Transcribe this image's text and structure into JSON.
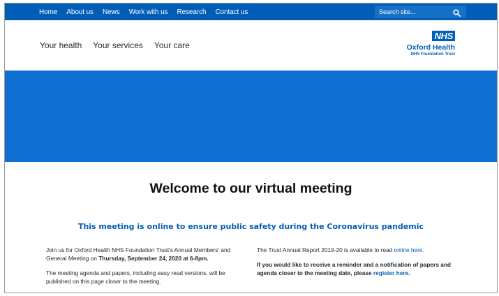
{
  "topbar": {
    "nav": [
      "Home",
      "About us",
      "News",
      "Work with us",
      "Research",
      "Contact us"
    ],
    "search_placeholder": "Search site..."
  },
  "header": {
    "nav": [
      "Your health",
      "Your services",
      "Your care"
    ],
    "logo": {
      "badge": "NHS",
      "name": "Oxford Health",
      "sub": "NHS Foundation Trust"
    }
  },
  "colors": {
    "nhs_blue": "#005eb8",
    "banner": "#0f6fd3"
  },
  "content": {
    "title": "Welcome to our virtual meeting",
    "subheading": "This meeting is online to ensure public safety during the Coronavirus pandemic",
    "left": {
      "p1_text": "Join us for Oxford Health NHS Foundation Trust's Annual Members' and General Meeting on ",
      "p1_bold": "Thursday, September 24, 2020 at 6-8pm.",
      "p2": "The meeting agenda and papers, including easy read versions, will be published on this page closer to the meeting."
    },
    "right": {
      "p1_text": "The Trust Annual Report 2019-20 is available to read ",
      "p1_link": "online here.",
      "p2_text": "If you would like to receive a reminder and a notification of papers and agenda closer to the meeting date, please ",
      "p2_link": "register here",
      "p2_end": "."
    }
  }
}
